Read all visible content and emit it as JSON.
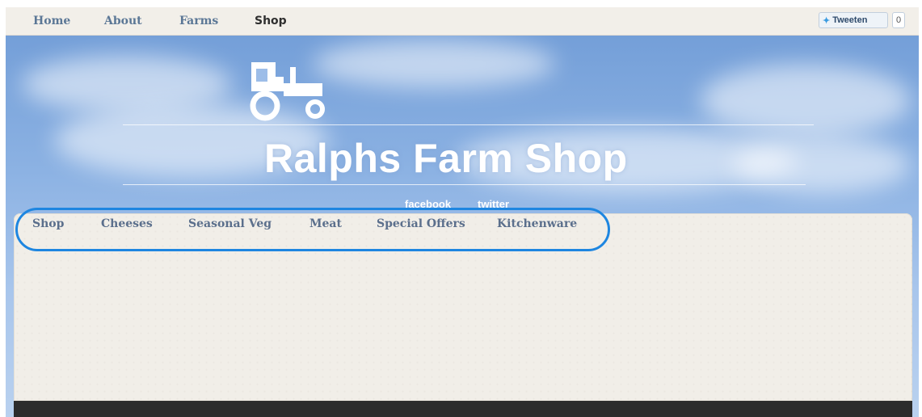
{
  "topnav": {
    "items": [
      {
        "label": "Home"
      },
      {
        "label": "About"
      },
      {
        "label": "Farms"
      },
      {
        "label": "Shop",
        "active": true
      }
    ]
  },
  "twitter": {
    "button_label": "Tweeten",
    "count": "0",
    "bird_icon": "twitter-bird-icon"
  },
  "header": {
    "logo_icon": "tractor-icon",
    "title": "Ralphs Farm Shop",
    "social": [
      "facebook",
      "twitter"
    ]
  },
  "categories": {
    "items": [
      {
        "label": "Shop"
      },
      {
        "label": "Cheeses"
      },
      {
        "label": "Seasonal Veg"
      },
      {
        "label": "Meat"
      },
      {
        "label": "Special Offers"
      },
      {
        "label": "Kitchenware"
      }
    ],
    "highlight_color": "#1e86e0"
  },
  "colors": {
    "sky": "#8cb2e3",
    "panel": "#f1eee8",
    "nav_text": "#5b7796",
    "footer": "#2c2c2c"
  }
}
